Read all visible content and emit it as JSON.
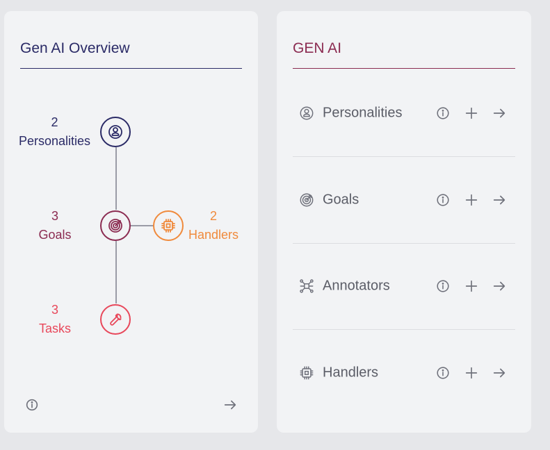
{
  "overview": {
    "title": "Gen AI Overview",
    "nodes": {
      "personalities": {
        "count": "2",
        "label": "Personalities",
        "color": "#2a2a66",
        "icon": "user-circle-icon"
      },
      "goals": {
        "count": "3",
        "label": "Goals",
        "color": "#8b2b51",
        "icon": "target-icon"
      },
      "handlers": {
        "count": "2",
        "label": "Handlers",
        "color": "#f08a3c",
        "icon": "chip-icon"
      },
      "tasks": {
        "count": "3",
        "label": "Tasks",
        "color": "#e8475a",
        "icon": "wrench-icon"
      }
    },
    "footer": {
      "info_icon": "info-icon",
      "arrow_icon": "arrow-right-icon"
    }
  },
  "genai": {
    "title": "GEN AI",
    "items": [
      {
        "label": "Personalities",
        "icon": "user-circle-icon"
      },
      {
        "label": "Goals",
        "icon": "target-icon"
      },
      {
        "label": "Annotators",
        "icon": "network-icon"
      },
      {
        "label": "Handlers",
        "icon": "chip-icon"
      }
    ],
    "actions": [
      "info-icon",
      "plus-icon",
      "arrow-right-icon"
    ]
  },
  "colors": {
    "primary": "#2a2a66",
    "accent": "#8b2b51",
    "orange": "#f08a3c",
    "red": "#e8475a",
    "muted": "#6f717b"
  }
}
